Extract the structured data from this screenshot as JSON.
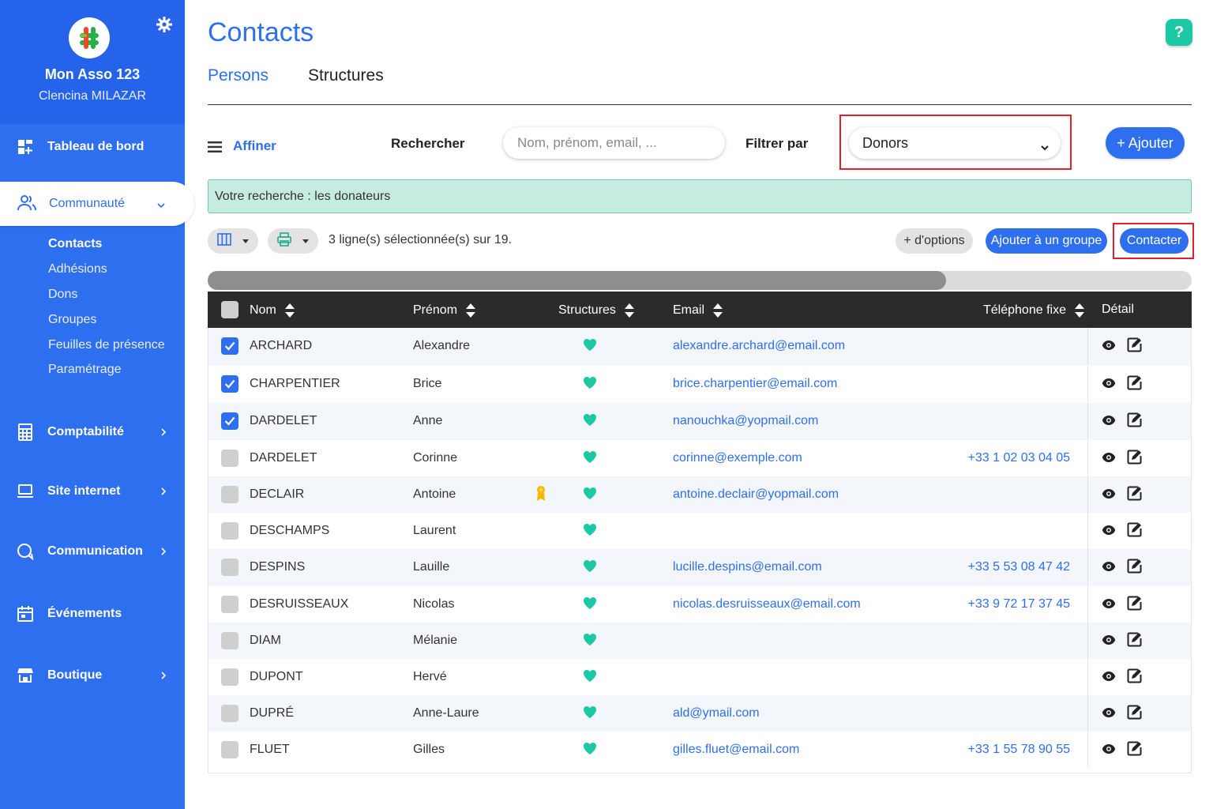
{
  "sidebar": {
    "org_name": "Mon Asso 123",
    "user_name": "Clencina MILAZAR",
    "brand_color": "#2e6ff0",
    "items": [
      {
        "label": "Tableau de bord",
        "icon": "dashboard-icon"
      },
      {
        "label": "Communauté",
        "icon": "users-icon"
      },
      {
        "label": "Comptabilité",
        "icon": "calculator-icon"
      },
      {
        "label": "Site internet",
        "icon": "laptop-icon"
      },
      {
        "label": "Communication",
        "icon": "chat-icon"
      },
      {
        "label": "Événements",
        "icon": "calendar-icon"
      },
      {
        "label": "Boutique",
        "icon": "shop-icon"
      }
    ],
    "subitems": [
      "Contacts",
      "Adhésions",
      "Dons",
      "Groupes",
      "Feuilles de présence",
      "Paramétrage"
    ]
  },
  "header": {
    "title": "Contacts",
    "help_label": "?"
  },
  "tabs": [
    "Persons",
    "Structures"
  ],
  "toolbar": {
    "refine_label": "Affiner",
    "search_label": "Rechercher",
    "search_placeholder": "Nom, prénom, email, ...",
    "filter_label": "Filtrer par",
    "filter_value": "Donors",
    "add_label": "+ Ajouter"
  },
  "info": "Votre recherche : les donateurs",
  "actions": {
    "selection_text": "3 ligne(s) sélectionnée(s) sur 19.",
    "options_label": "+ d'options",
    "group_label": "Ajouter à un groupe",
    "contact_label": "Contacter"
  },
  "table": {
    "scroll_position": 0.75,
    "headers": {
      "nom": "Nom",
      "prenom": "Prénom",
      "structures": "Structures",
      "email": "Email",
      "telephone": "Téléphone fixe",
      "detail": "Détail"
    },
    "rows": [
      {
        "checked": true,
        "nom": "ARCHARD",
        "prenom": "Alexandre",
        "award": false,
        "email": "alexandre.archard@email.com",
        "phone": ""
      },
      {
        "checked": true,
        "nom": "CHARPENTIER",
        "prenom": "Brice",
        "award": false,
        "email": "brice.charpentier@email.com",
        "phone": ""
      },
      {
        "checked": true,
        "nom": "DARDELET",
        "prenom": "Anne",
        "award": false,
        "email": "nanouchka@yopmail.com",
        "phone": ""
      },
      {
        "checked": false,
        "nom": "DARDELET",
        "prenom": "Corinne",
        "award": false,
        "email": "corinne@exemple.com",
        "phone": "+33 1 02 03 04 05"
      },
      {
        "checked": false,
        "nom": "DECLAIR",
        "prenom": "Antoine",
        "award": true,
        "email": "antoine.declair@yopmail.com",
        "phone": ""
      },
      {
        "checked": false,
        "nom": "DESCHAMPS",
        "prenom": "Laurent",
        "award": false,
        "email": "",
        "phone": ""
      },
      {
        "checked": false,
        "nom": "DESPINS",
        "prenom": "Lauille",
        "award": false,
        "email": "lucille.despins@email.com",
        "phone": "+33 5 53 08 47 42"
      },
      {
        "checked": false,
        "nom": "DESRUISSEAUX",
        "prenom": "Nicolas",
        "award": false,
        "email": "nicolas.desruisseaux@email.com",
        "phone": "+33 9 72 17 37 45"
      },
      {
        "checked": false,
        "nom": "DIAM",
        "prenom": "Mélanie",
        "award": false,
        "email": "",
        "phone": ""
      },
      {
        "checked": false,
        "nom": "DUPONT",
        "prenom": "Hervé",
        "award": false,
        "email": "",
        "phone": ""
      },
      {
        "checked": false,
        "nom": "DUPRÉ",
        "prenom": "Anne-Laure",
        "award": false,
        "email": "ald@ymail.com",
        "phone": ""
      },
      {
        "checked": false,
        "nom": "FLUET",
        "prenom": "Gilles",
        "award": false,
        "email": "gilles.fluet@email.com",
        "phone": "+33 1 55 78 90 55"
      }
    ]
  }
}
